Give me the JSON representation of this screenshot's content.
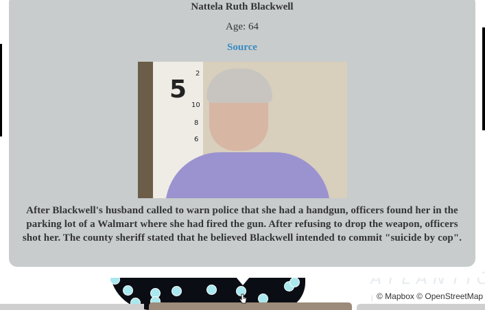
{
  "popup": {
    "name": "Nattela Ruth Blackwell",
    "age": "Age: 64",
    "source_link": "Source",
    "photo_alt": "Nattela Ruth Blackwell",
    "description": "After Blackwell's husband called to warn police that she had a handgun, officers found her in the parking lot of a Walmart where she had fired the gun. After refusing to drop the weapon, officers shot her. The county sheriff stated that he believed Blackwell intended to commit \"suicide by cop\"."
  },
  "map": {
    "attribution": "© Mapbox © OpenStreetMap",
    "ocean_label": "ATLANTIC O",
    "marker_color": "#a9e8ee"
  },
  "colors": {
    "popup_bg": "#c8cccd",
    "link": "#3a8cc1"
  }
}
